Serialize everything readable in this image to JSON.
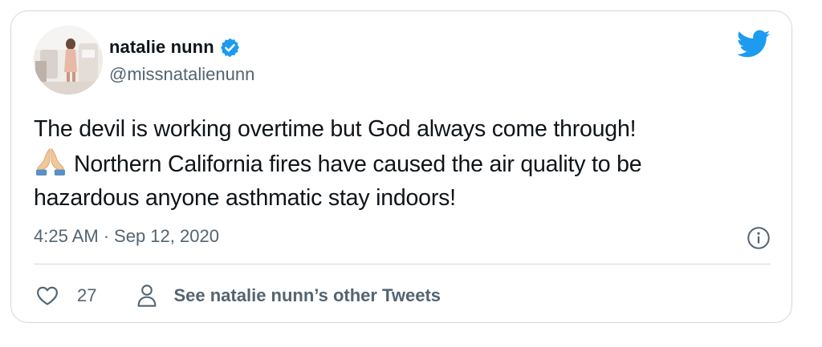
{
  "tweet": {
    "author": {
      "display_name": "natalie nunn",
      "handle": "@missnatalienunn",
      "verified": true
    },
    "text_lines": [
      "The devil is working overtime but God always come through!",
      "Northern California fires have caused the air quality to be",
      "hazardous anyone asthmatic stay indoors!"
    ],
    "emoji": "folded-hands-emoji",
    "time": "4:25 AM",
    "separator": "·",
    "date": "Sep 12, 2020"
  },
  "actions": {
    "like_count": "27",
    "other_tweets_label": "See natalie nunn’s other Tweets"
  },
  "icons": {
    "brand": "twitter-bird-icon",
    "verified": "verified-badge-icon",
    "info": "info-icon",
    "like": "heart-icon",
    "profile": "person-icon"
  },
  "colors": {
    "brand_blue": "#1d9bf0",
    "text_primary": "#0f1419",
    "text_secondary": "#536471",
    "border": "#cfd9de"
  }
}
